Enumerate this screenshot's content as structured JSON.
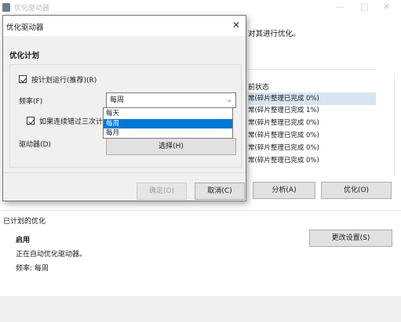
{
  "window": {
    "title": "优化驱动器",
    "minimize_glyph": "—",
    "maximize_glyph": "□",
    "close_glyph": "✕"
  },
  "main": {
    "description": "对其进行优化。",
    "status_header": "前状态",
    "status_rows": [
      "常(碎片整理已完成 0%)",
      "常(碎片整理已完成 1%)",
      "常(碎片整理已完成 0%)",
      "常(碎片整理已完成 0%)",
      "常(碎片整理已完成 0%)",
      "常(碎片整理已完成 0%)"
    ],
    "analyze_label": "分析(A)",
    "optimize_label": "优化(O)"
  },
  "scheduled": {
    "title": "已计划的优化",
    "state": "启用",
    "running_text": "正在自动优化驱动器。",
    "frequency_text": "频率: 每周",
    "change_settings_label": "更改设置(S)"
  },
  "dialog": {
    "title": "优化驱动器",
    "close_glyph": "✕",
    "plan_title": "优化计划",
    "schedule_label": "按计划运行(推荐)(R)",
    "frequency_label": "频率(F)",
    "frequency_value": "每周",
    "chevron_glyph": "⌄",
    "missed_label": "如果连续错过三次计",
    "drives_label": "驱动器(D)",
    "select_drives_label": "选择(H)",
    "ok_label": "确定(O)",
    "cancel_label": "取消(C)",
    "frequency_options": [
      "每天",
      "每周",
      "每月"
    ],
    "selected_option_index": 1
  },
  "colors": {
    "accent": "#0078d7",
    "selection_bg": "#d8e4f1"
  }
}
